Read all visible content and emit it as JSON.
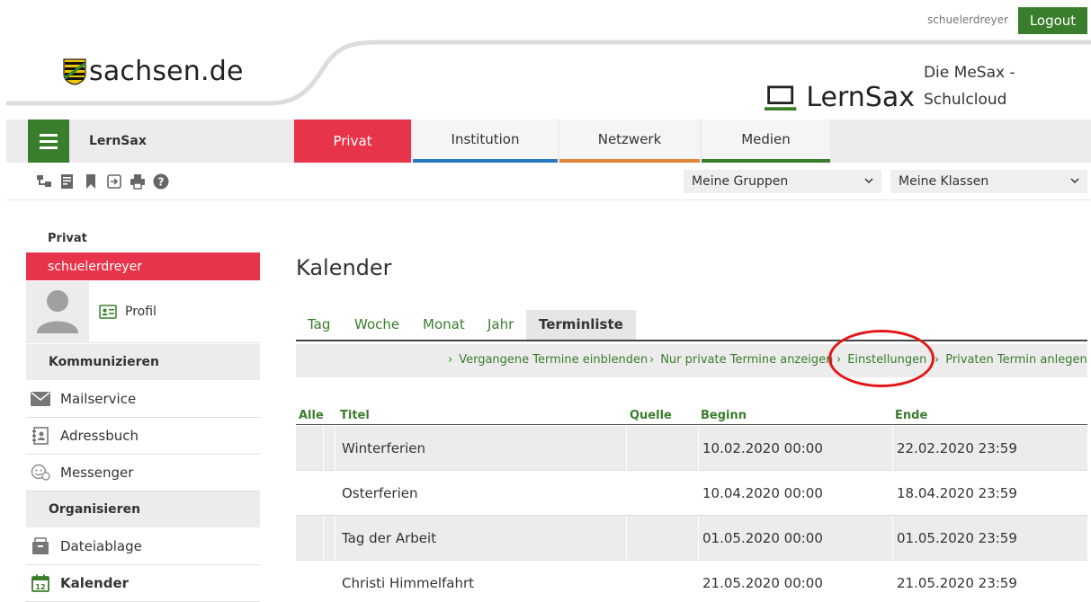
{
  "header": {
    "username": "schuelerdreyer",
    "logout_label": "Logout",
    "sachsen_logo_text": "sachsen.de",
    "lernsax_name": "LernSax",
    "lernsax_tagline": "Die MeSax - Schulcloud"
  },
  "nav": {
    "app_name": "LernSax",
    "tabs": [
      {
        "label": "Privat",
        "active": true,
        "color": "#e8344a"
      },
      {
        "label": "Institution",
        "active": false,
        "color": "#2a79c0"
      },
      {
        "label": "Netzwerk",
        "active": false,
        "color": "#e0873a"
      },
      {
        "label": "Medien",
        "active": false,
        "color": "#3a7d2c"
      }
    ]
  },
  "toolbar": {
    "icons": [
      "sitemap-icon",
      "note-icon",
      "bookmark-icon",
      "login-icon",
      "print-icon",
      "help-icon"
    ],
    "groups_select": "Meine Gruppen",
    "classes_select": "Meine Klassen"
  },
  "sidebar": {
    "privat_heading": "Privat",
    "user": "schuelerdreyer",
    "profil": "Profil",
    "sections": [
      {
        "title": "Kommunizieren",
        "items": [
          "Mailservice",
          "Adressbuch",
          "Messenger"
        ]
      },
      {
        "title": "Organisieren",
        "items": [
          "Dateiablage",
          "Kalender"
        ]
      }
    ],
    "active_item": "Kalender"
  },
  "main": {
    "title": "Kalender",
    "tabs": [
      "Tag",
      "Woche",
      "Monat",
      "Jahr",
      "Terminliste"
    ],
    "active_tab": "Terminliste",
    "actions": [
      "Vergangene Termine einblenden",
      "Nur private Termine anzeigen",
      "Einstellungen",
      "Privaten Termin anlegen"
    ],
    "table": {
      "headers": [
        "Alle",
        "Titel",
        "Quelle",
        "Beginn",
        "Ende"
      ],
      "rows": [
        {
          "titel": "Winterferien",
          "quelle": "",
          "beginn": "10.02.2020 00:00",
          "ende": "22.02.2020 23:59"
        },
        {
          "titel": "Osterferien",
          "quelle": "",
          "beginn": "10.04.2020 00:00",
          "ende": "18.04.2020 23:59"
        },
        {
          "titel": "Tag der Arbeit",
          "quelle": "",
          "beginn": "01.05.2020 00:00",
          "ende": "01.05.2020 23:59"
        },
        {
          "titel": "Christi Himmelfahrt",
          "quelle": "",
          "beginn": "21.05.2020 00:00",
          "ende": "21.05.2020 23:59"
        }
      ]
    }
  },
  "colors": {
    "green": "#3a7d2c",
    "red": "#e8344a",
    "highlight": "#e3171a"
  }
}
